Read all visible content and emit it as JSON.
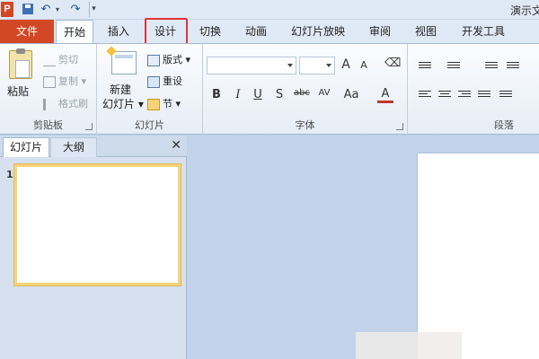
{
  "titlebar": {
    "app_icon": "P",
    "doc_title": "演示文",
    "quick_access": {
      "save": "save-icon",
      "undo": "↶",
      "undo_dd": "▾",
      "redo": "↷",
      "customize": "▾"
    }
  },
  "tabs": {
    "file": "文件",
    "home": "开始",
    "insert": "插入",
    "design": "设计",
    "transitions": "切换",
    "animations": "动画",
    "slideshow": "幻灯片放映",
    "review": "审阅",
    "view": "视图",
    "developer": "开发工具"
  },
  "clipboard": {
    "label": "剪贴板",
    "paste": "粘贴",
    "cut": "剪切",
    "copy": "复制",
    "format_painter": "格式刷",
    "copy_dd": "▾"
  },
  "slides_group": {
    "label": "幻灯片",
    "new_slide_1": "新建",
    "new_slide_2": "幻灯片",
    "dd": "▾",
    "layout": "版式",
    "reset": "重设",
    "section": "节"
  },
  "font_group": {
    "label": "字体",
    "grow": "A",
    "shrink": "A",
    "bold": "B",
    "italic": "I",
    "underline": "U",
    "shadow": "S",
    "strike": "abc",
    "spacing": "AV",
    "case": "Aa",
    "color": "A"
  },
  "paragraph_group": {
    "label": "段落"
  },
  "slide_pane": {
    "tab_slides": "幻灯片",
    "tab_outline": "大纲",
    "close": "✕",
    "slide_number": "1"
  },
  "colors": {
    "accent": "#d24726",
    "highlight": "#e2333b",
    "ribbon_border": "#a6b9d1"
  }
}
